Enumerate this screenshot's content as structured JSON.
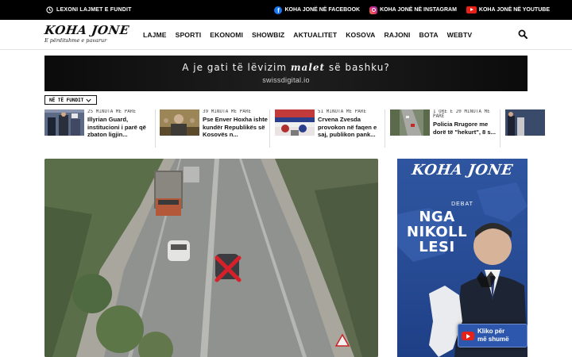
{
  "topbar": {
    "latest_label": "LEXONI LAJMET E FUNDIT",
    "social": [
      {
        "icon": "facebook-icon",
        "label": "KOHA JONË NË FACEBOOK"
      },
      {
        "icon": "instagram-icon",
        "label": "KOHA JONË NË INSTAGRAM"
      },
      {
        "icon": "youtube-icon",
        "label": "KOHA JONË NË YOUTUBE"
      }
    ]
  },
  "header": {
    "logo_name": "KOHA JONE",
    "logo_tagline": "E përditshme e pavarur",
    "nav": [
      "LAJME",
      "SPORTI",
      "EKONOMI",
      "SHOWBIZ",
      "AKTUALITET",
      "KOSOVA",
      "RAJONI",
      "BOTA",
      "WEBTV"
    ],
    "search_icon": "search-icon"
  },
  "banner": {
    "line1_pre": "A je gati të lëvizim",
    "line1_em": "malet",
    "line1_post": "së bashku?",
    "line2": "swissdigital.io"
  },
  "latest": {
    "label": "NË TË FUNDIT",
    "items": [
      {
        "time": "25 MINUTA MË PARË",
        "title": "Illyrian Guard, institucioni i parë që zbaton ligjin..."
      },
      {
        "time": "39 MINUTA MË PARË",
        "title": "Pse Enver Hoxha ishte kundër Republikës së Kosovës n..."
      },
      {
        "time": "51 MINUTA MË PARË",
        "title": "Crvena Zvesda provokon në faqen e saj, publikon pank..."
      },
      {
        "time": "1 ORË E 20 MINUTA MË PARË",
        "title": "Policia Rrugore me dorë të \"hekurt\", 8 s..."
      }
    ]
  },
  "sidead": {
    "brand": "KOHA JONE",
    "debat": "DEBAT",
    "guest_line1": "NGA",
    "guest_line2": "NIKOLL",
    "guest_line3": "LESI",
    "cta_line1": "Kliko për",
    "cta_line2": "më shumë"
  },
  "colors": {
    "topbar_bg": "#000000",
    "ad_blue": "#2a4f98",
    "youtube_red": "#e62117",
    "marker_red": "#d8202a"
  }
}
